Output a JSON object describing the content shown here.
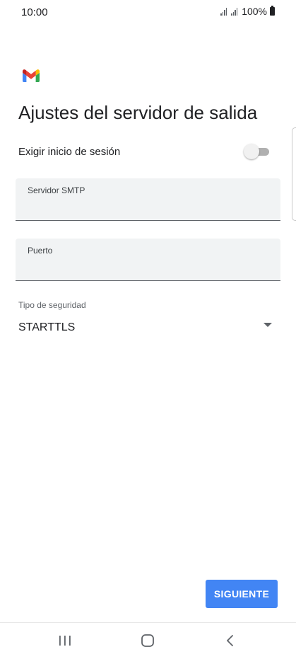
{
  "status_bar": {
    "time": "10:00",
    "battery": "100%",
    "icons": [
      "signal-icon",
      "signal-icon",
      "battery-icon"
    ]
  },
  "app": {
    "logo_icon": "gmail-logo-icon"
  },
  "page": {
    "title": "Ajustes del servidor de salida"
  },
  "require_login": {
    "label": "Exigir inicio de sesión",
    "enabled": false
  },
  "smtp_server": {
    "label": "Servidor SMTP",
    "value": ""
  },
  "port": {
    "label": "Puerto",
    "value": ""
  },
  "security": {
    "label": "Tipo de seguridad",
    "selected": "STARTTLS"
  },
  "actions": {
    "next_label": "SIGUIENTE",
    "accent": "#4285f4"
  },
  "nav_bar": {
    "icons": [
      "recent-apps-icon",
      "home-icon",
      "back-icon"
    ]
  }
}
